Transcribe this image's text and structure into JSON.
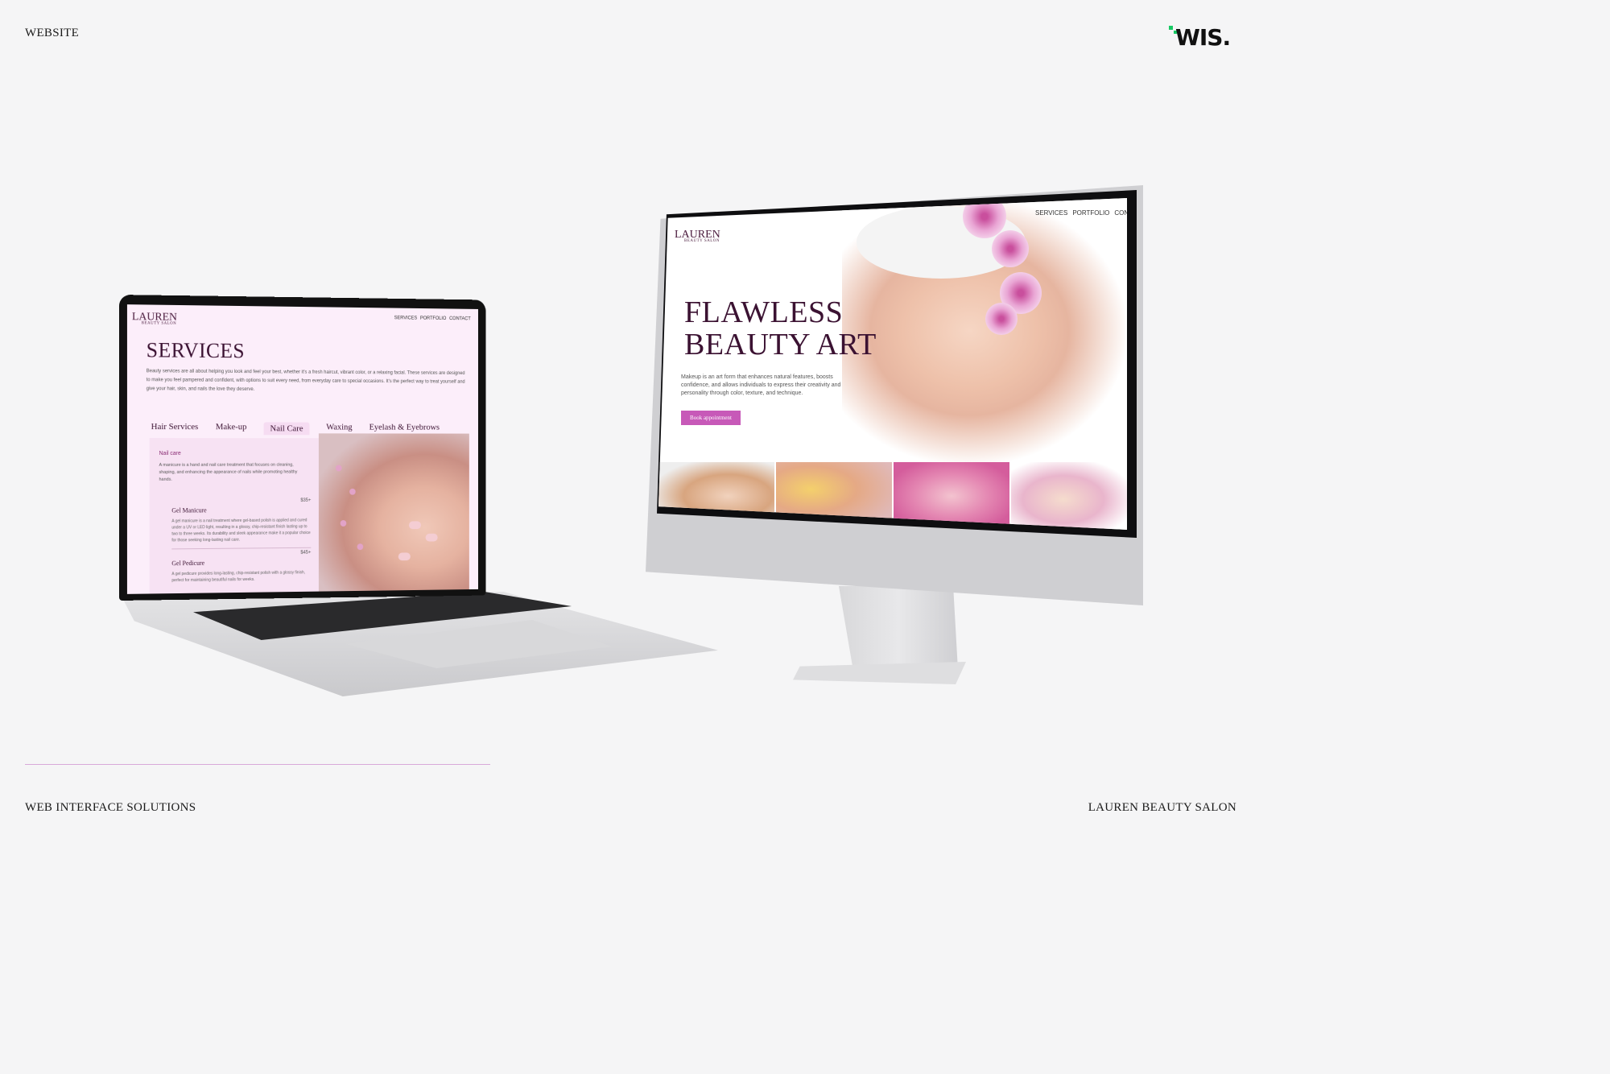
{
  "page": {
    "top_left_label": "WEBSITE",
    "bottom_left_label": "WEB INTERFACE SOLUTIONS",
    "bottom_right_label": "LAUREN BEAUTY SALON",
    "logo_text": "WIS.",
    "accent_color": "#c759b8",
    "brand_dark_color": "#3b1232"
  },
  "laptop": {
    "brand": {
      "name": "LAUREN",
      "sub": "BEAUTY SALON"
    },
    "nav": [
      "SERVICES",
      "PORTFOLIO",
      "CONTACT"
    ],
    "title": "SERVICES",
    "intro": "Beauty services are all about helping you look and feel your best, whether it's a fresh haircut, vibrant color, or a relaxing facial. These services are designed to make you feel pampered and confident, with options to suit every need, from everyday care to special occasions. It's the perfect way to treat yourself and give your hair, skin, and nails the love they deserve.",
    "tabs": [
      "Hair Services",
      "Make-up",
      "Nail Care",
      "Waxing",
      "Eyelash & Eyebrows"
    ],
    "active_tab": "Nail Care",
    "section_title": "Nail care",
    "section_desc": "A manicure is a hand and nail care treatment that focuses on cleaning, shaping, and enhancing the appearance of nails while promoting healthy hands.",
    "items": [
      {
        "name": "Gel Manicure",
        "price": "$35+",
        "desc": "A gel manicure is a nail treatment where gel-based polish is applied and cured under a UV or LED light, resulting in a glossy, chip-resistant finish lasting up to two to three weeks. Its durability and sleek appearance make it a popular choice for those seeking long-lasting nail care."
      },
      {
        "name": "Gel Pedicure",
        "price": "$45+",
        "desc": "A gel pedicure provides long-lasting, chip-resistant polish with a glossy finish, perfect for maintaining beautiful nails for weeks."
      }
    ]
  },
  "monitor": {
    "brand": {
      "name": "LAUREN",
      "sub": "BEAUTY SALON"
    },
    "nav": [
      "SERVICES",
      "PORTFOLIO",
      "CONTACT"
    ],
    "title_line1": "FLAWLESS",
    "title_line2": "BEAUTY ART",
    "text": "Makeup is an art form that enhances natural features, boosts confidence, and allows individuals to express their creativity and personality through color, texture, and technique.",
    "button": "Book appointment"
  }
}
